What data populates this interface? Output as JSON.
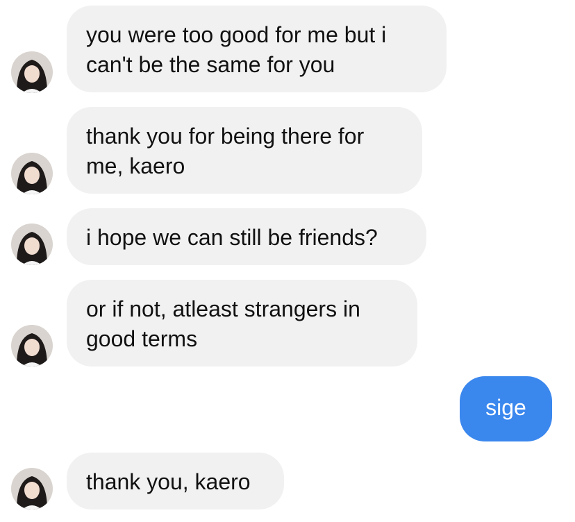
{
  "conversation": {
    "messages": [
      {
        "sender": "contact",
        "lines": [
          "you were too good for me but i",
          "can't be the same for you"
        ]
      },
      {
        "sender": "contact",
        "lines": [
          "thank you for being there for",
          "me, kaero"
        ]
      },
      {
        "sender": "contact",
        "lines": [
          "i hope we can still be friends?"
        ]
      },
      {
        "sender": "contact",
        "lines": [
          "or if not, atleast strangers in",
          "good terms"
        ]
      },
      {
        "sender": "me",
        "lines": [
          "sige"
        ]
      },
      {
        "sender": "contact",
        "lines": [
          "thank you, kaero"
        ]
      }
    ]
  },
  "colors": {
    "incoming_bubble": "#f1f1f1",
    "outgoing_bubble": "#3a87ee",
    "incoming_text": "#111111",
    "outgoing_text": "#ffffff"
  },
  "icons": {
    "contact_avatar": "contact-avatar-photo"
  }
}
